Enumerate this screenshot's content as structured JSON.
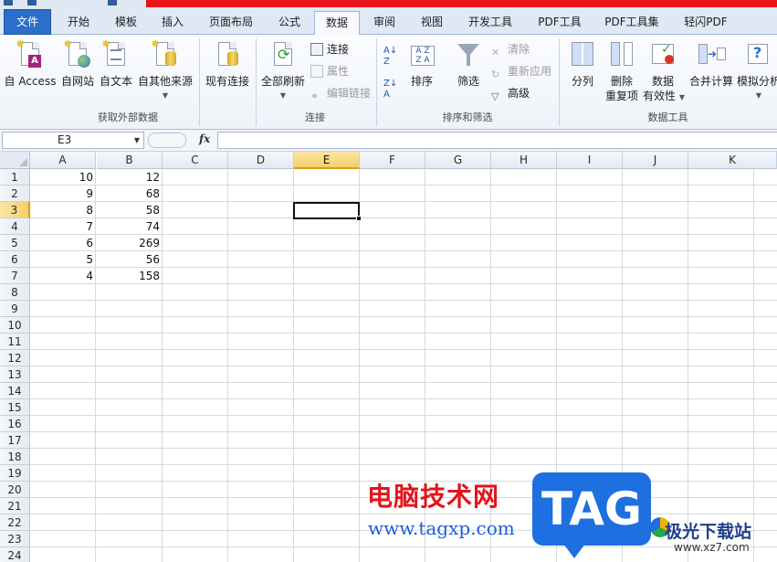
{
  "tabs": [
    "文件",
    "开始",
    "模板",
    "插入",
    "页面布局",
    "公式",
    "数据",
    "审阅",
    "视图",
    "开发工具",
    "PDF工具",
    "PDF工具集",
    "轻闪PDF"
  ],
  "active_tab": "数据",
  "ribbon": {
    "groups": {
      "external": "获取外部数据",
      "connections": "连接",
      "sort_filter": "排序和筛选",
      "data_tools": "数据工具"
    },
    "external": {
      "access": "自 Access",
      "web": "自网站",
      "text": "自文本",
      "other": "自其他来源",
      "existing": "现有连接"
    },
    "connections": {
      "refresh_all": "全部刷新",
      "connections": "连接",
      "properties": "属性",
      "edit_links": "编辑链接"
    },
    "sort_filter": {
      "sort": "排序",
      "filter": "筛选",
      "clear": "清除",
      "reapply": "重新应用",
      "advanced": "高级"
    },
    "data_tools": {
      "text_to_columns": "分列",
      "remove_dup_1": "删除",
      "remove_dup_2": "重复项",
      "validation_1": "数据",
      "validation_2": "有效性",
      "consolidate": "合并计算",
      "what_if": "模拟分析"
    }
  },
  "formula_bar": {
    "name_box": "E3",
    "fx_label": "fx",
    "formula": ""
  },
  "sheet": {
    "columns": [
      "A",
      "B",
      "C",
      "D",
      "E",
      "F",
      "G",
      "H",
      "I",
      "J",
      "K"
    ],
    "selected_column": "E",
    "rows": [
      "1",
      "2",
      "3",
      "4",
      "5",
      "6",
      "7",
      "8",
      "9",
      "10",
      "11",
      "12",
      "13",
      "14",
      "15",
      "16",
      "17",
      "18",
      "19",
      "20",
      "21",
      "22",
      "23",
      "24"
    ],
    "selected_row": "3",
    "data": [
      [
        "10",
        "12"
      ],
      [
        "9",
        "68"
      ],
      [
        "8",
        "58"
      ],
      [
        "7",
        "74"
      ],
      [
        "6",
        "269"
      ],
      [
        "5",
        "56"
      ],
      [
        "4",
        "158"
      ]
    ]
  },
  "watermark": {
    "chinese": "电脑技术网",
    "url": "www.tagxp.com",
    "tag": "TAG",
    "site_name": "极光下载站",
    "site_url": "www.xz7.com"
  },
  "colors": {
    "accent_red": "#e8141a",
    "file_tab": "#2a6fc9",
    "selection": "#f5cf68"
  }
}
